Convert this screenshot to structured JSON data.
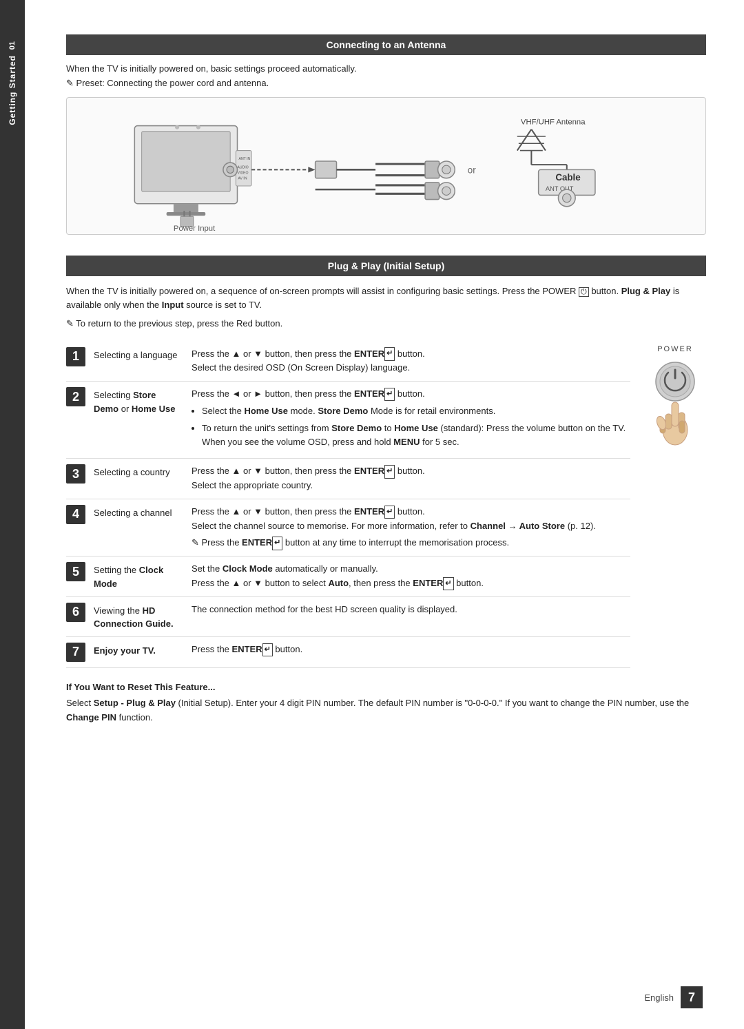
{
  "side_tab": {
    "number": "01",
    "text": "Getting Started"
  },
  "antenna_section": {
    "header": "Connecting to an Antenna",
    "intro": "When the TV is initially powered on, basic settings proceed automatically.",
    "preset": "Preset: Connecting the power cord and antenna.",
    "vhf_label": "VHF/UHF Antenna",
    "cable_label": "Cable",
    "ant_out_label": "ANT OUT",
    "power_input_label": "Power Input",
    "or_text": "or"
  },
  "plug_play_section": {
    "header": "Plug & Play (Initial Setup)",
    "body1": "When the TV is initially powered on, a sequence of on-screen prompts will assist in configuring basic settings. Press the POWER  button. Plug & Play is available only when the Input source is set to TV.",
    "note": "To return to the previous step, press the Red button.",
    "power_label": "POWER"
  },
  "steps": [
    {
      "number": "1",
      "label": "Selecting a language",
      "description": "Press the ▲ or ▼ button, then press the ENTER  button.\nSelect the desired OSD (On Screen Display) language."
    },
    {
      "number": "2",
      "label": "Selecting Store Demo or Home Use",
      "description": "Press the ◄ or ► button, then press the ENTER  button.",
      "bullets": [
        "Select the Home Use mode. Store Demo Mode is for retail environments.",
        "To return the unit's settings from Store Demo to Home Use (standard): Press the volume button on the TV. When you see the volume OSD, press and hold MENU for 5 sec."
      ]
    },
    {
      "number": "3",
      "label": "Selecting a country",
      "description": "Press the ▲ or ▼ button, then press the ENTER  button.\nSelect the appropriate country."
    },
    {
      "number": "4",
      "label": "Selecting a channel",
      "description": "Press the ▲ or ▼ button, then press the ENTER  button.\nSelect the channel source to memorise. For more information, refer to Channel → Auto Store (p. 12).",
      "note": "Press the ENTER  button at any time to interrupt the memorisation process."
    },
    {
      "number": "5",
      "label": "Setting the Clock Mode",
      "description": "Set the Clock Mode automatically or manually.\nPress the ▲ or ▼ button to select Auto, then press the ENTER  button."
    },
    {
      "number": "6",
      "label": "Viewing the HD Connection Guide.",
      "description": "The connection method for the best HD screen quality is displayed."
    },
    {
      "number": "7",
      "label": "Enjoy your TV.",
      "description": "Press the ENTER  button."
    }
  ],
  "reset_section": {
    "title": "If You Want to Reset This Feature...",
    "text": "Select Setup - Plug & Play (Initial Setup). Enter your 4 digit PIN number. The default PIN number is \"0-0-0-0.\" If you want to change the PIN number, use the Change PIN function."
  },
  "footer": {
    "language": "English",
    "page": "7"
  }
}
